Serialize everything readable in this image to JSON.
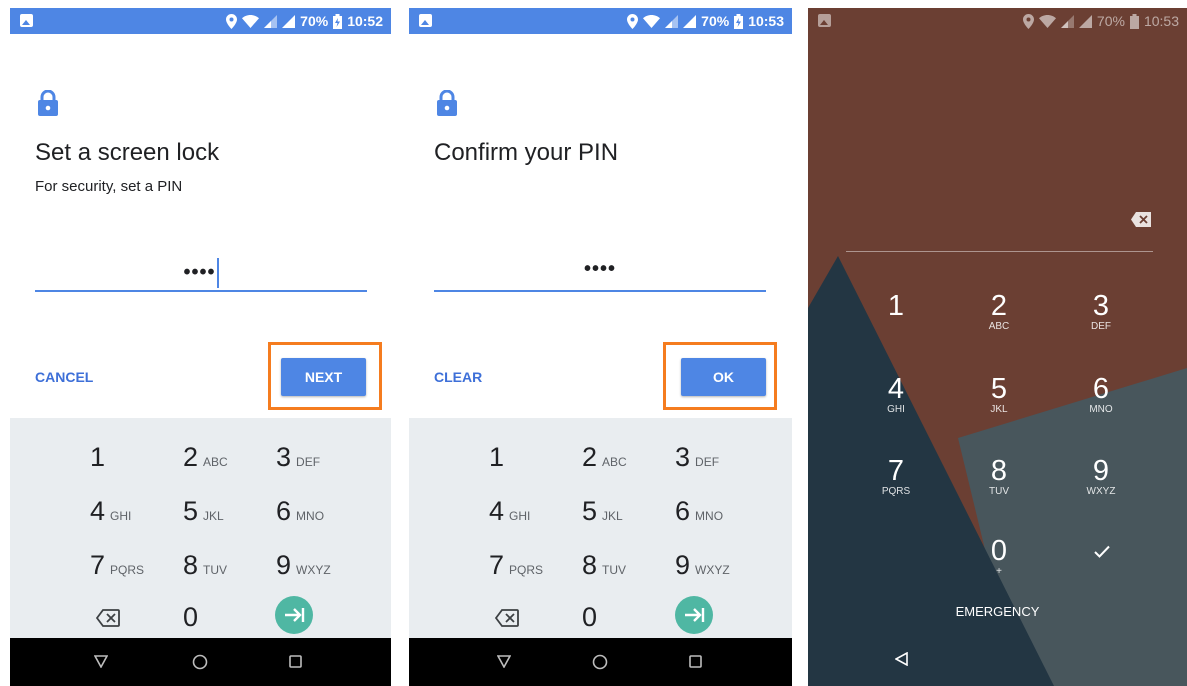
{
  "screens": [
    {
      "status": {
        "battery": "70%",
        "time": "10:52"
      },
      "title": "Set a screen lock",
      "subtitle": "For security, set a PIN",
      "pin_dots": "••••",
      "left_button": "CANCEL",
      "right_button": "NEXT"
    },
    {
      "status": {
        "battery": "70%",
        "time": "10:53"
      },
      "title": "Confirm your PIN",
      "pin_dots": "••••",
      "left_button": "CLEAR",
      "right_button": "OK"
    },
    {
      "status": {
        "battery": "70%",
        "time": "10:53"
      },
      "emergency": "EMERGENCY",
      "zero_sub": "+"
    }
  ],
  "keypad": [
    {
      "num": "1",
      "letters": ""
    },
    {
      "num": "2",
      "letters": "ABC"
    },
    {
      "num": "3",
      "letters": "DEF"
    },
    {
      "num": "4",
      "letters": "GHI"
    },
    {
      "num": "5",
      "letters": "JKL"
    },
    {
      "num": "6",
      "letters": "MNO"
    },
    {
      "num": "7",
      "letters": "PQRS"
    },
    {
      "num": "8",
      "letters": "TUV"
    },
    {
      "num": "9",
      "letters": "WXYZ"
    },
    {
      "num": "0",
      "letters": ""
    }
  ],
  "icons": {
    "lock": "lock-icon",
    "backspace": "backspace-icon",
    "go": "go-arrow-icon",
    "nav_back": "nav-back-icon",
    "nav_home": "nav-home-icon",
    "nav_recents": "nav-recents-icon",
    "confirm": "check-icon"
  },
  "colors": {
    "accent": "#4e86e4",
    "highlight": "#f57c1f",
    "go_button": "#4fb7a3",
    "keypad_bg": "#e9edf0",
    "lockscreen_bg": "#6b3f33"
  }
}
